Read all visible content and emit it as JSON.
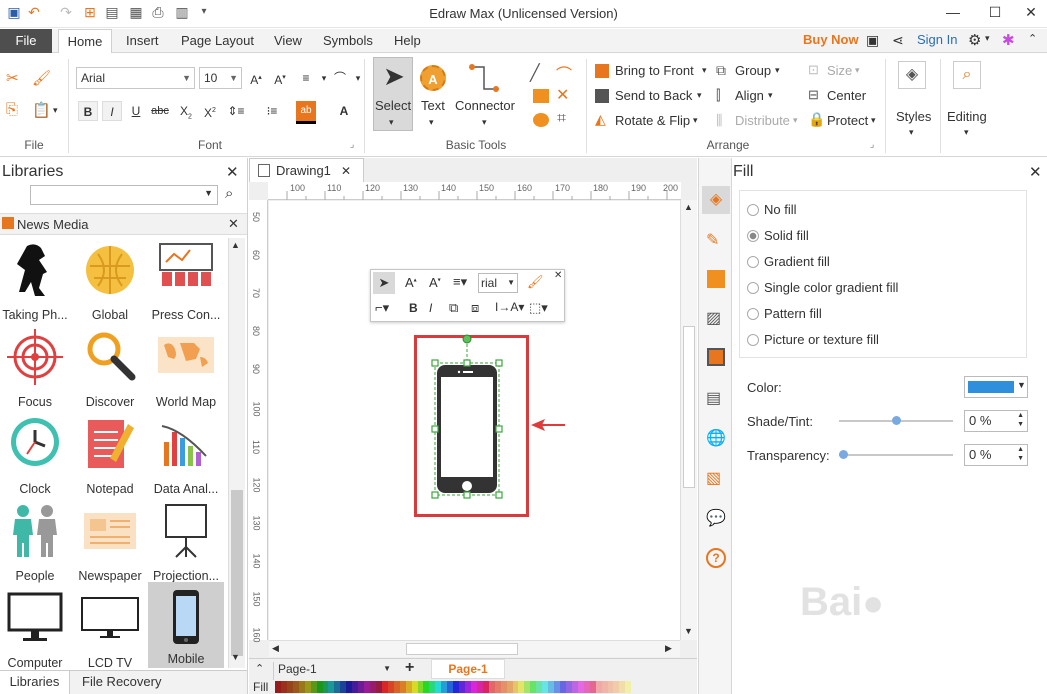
{
  "app": {
    "title": "Edraw Max (Unlicensed Version)"
  },
  "menu": {
    "file": "File",
    "tabs": [
      "Home",
      "Insert",
      "Page Layout",
      "View",
      "Symbols",
      "Help"
    ],
    "buy_now": "Buy Now",
    "sign_in": "Sign In"
  },
  "ribbon": {
    "file_group": "File",
    "font_group": "Font",
    "font_name": "Arial",
    "font_size": "10",
    "basic_tools_group": "Basic Tools",
    "select": "Select",
    "text": "Text",
    "connector": "Connector",
    "arrange_group": "Arrange",
    "bring_to_front": "Bring to Front",
    "send_to_back": "Send to Back",
    "rotate_flip": "Rotate & Flip",
    "group": "Group",
    "align": "Align",
    "distribute": "Distribute",
    "size": "Size",
    "center": "Center",
    "protect": "Protect",
    "styles": "Styles",
    "editing": "Editing"
  },
  "libraries": {
    "title": "Libraries",
    "search_placeholder": "",
    "category": "News Media",
    "items": [
      {
        "label": "Taking Ph..."
      },
      {
        "label": "Global"
      },
      {
        "label": "Press Con..."
      },
      {
        "label": "Focus"
      },
      {
        "label": "Discover"
      },
      {
        "label": "World Map"
      },
      {
        "label": "Clock"
      },
      {
        "label": "Notepad"
      },
      {
        "label": "Data Anal..."
      },
      {
        "label": "People"
      },
      {
        "label": "Newspaper"
      },
      {
        "label": "Projection..."
      },
      {
        "label": "Computer"
      },
      {
        "label": "LCD TV"
      },
      {
        "label": "Mobile"
      }
    ],
    "bottom_tabs": [
      "Libraries",
      "File Recovery"
    ]
  },
  "document": {
    "tab_name": "Drawing1",
    "ruler_h": [
      "100",
      "110",
      "120",
      "130",
      "140",
      "150",
      "160",
      "170",
      "180",
      "190",
      "200"
    ],
    "ruler_v": [
      "50",
      "60",
      "70",
      "80",
      "90",
      "100",
      "110",
      "120",
      "130",
      "140",
      "150",
      "160"
    ],
    "float_font": "rial"
  },
  "status": {
    "page_select": "Page-1",
    "page_tab": "Page-1",
    "fill_label": "Fill"
  },
  "fill_panel": {
    "title": "Fill",
    "options": [
      "No fill",
      "Solid fill",
      "Gradient fill",
      "Single color gradient fill",
      "Pattern fill",
      "Picture or texture fill"
    ],
    "selected": "Solid fill",
    "color_label": "Color:",
    "color_value": "#2f8fdc",
    "shade_label": "Shade/Tint:",
    "shade_value": "0 %",
    "transparency_label": "Transparency:",
    "transparency_value": "0 %"
  },
  "colors": {
    "accent": "#e8761e",
    "selection": "#3aa63a",
    "highlight_box": "#d83b3b",
    "arrow": "#e03a3a"
  }
}
